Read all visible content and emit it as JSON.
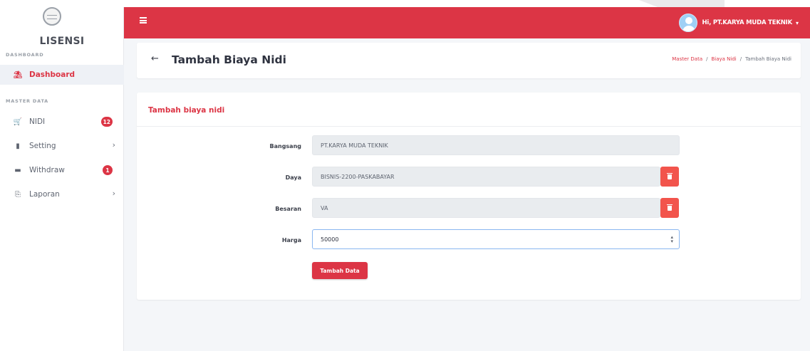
{
  "sidebar": {
    "brand": "LISENSI",
    "sections": {
      "dashboard": "DASHBOARD",
      "master_data": "MASTER DATA"
    },
    "items": [
      {
        "label": "Dashboard",
        "icon": "home-icon",
        "active": true
      },
      {
        "label": "NIDI",
        "icon": "cart-icon",
        "badge": "12"
      },
      {
        "label": "Setting",
        "icon": "book-icon",
        "chevron": true
      },
      {
        "label": "Withdraw",
        "icon": "card-icon",
        "badge": "1"
      },
      {
        "label": "Laporan",
        "icon": "printer-icon",
        "chevron": true
      }
    ]
  },
  "navbar": {
    "menu_icon": "hamburger-icon",
    "user_name": "Hi, PT.KARYA MUDA TEKNIK",
    "caret": "▾",
    "accent": "#dc3545"
  },
  "header": {
    "back_icon": "arrow-left-icon",
    "title": "Tambah Biaya Nidi",
    "breadcrumb": [
      "Master Data",
      "Biaya Nidi",
      "Tambah Biaya Nidi"
    ],
    "breadcrumb_sep": "/"
  },
  "form": {
    "card_title": "Tambah biaya nidi",
    "fields": [
      {
        "label": "Bangsang",
        "value": "PT.KARYA MUDA TEKNIK"
      },
      {
        "label": "Daya",
        "value": "BISNIS-2200-PASKABAYAR"
      },
      {
        "label": "Besaran",
        "value": "VA"
      },
      {
        "label": "Harga",
        "value": "50000"
      }
    ],
    "submit_label": "Tambah Data"
  }
}
